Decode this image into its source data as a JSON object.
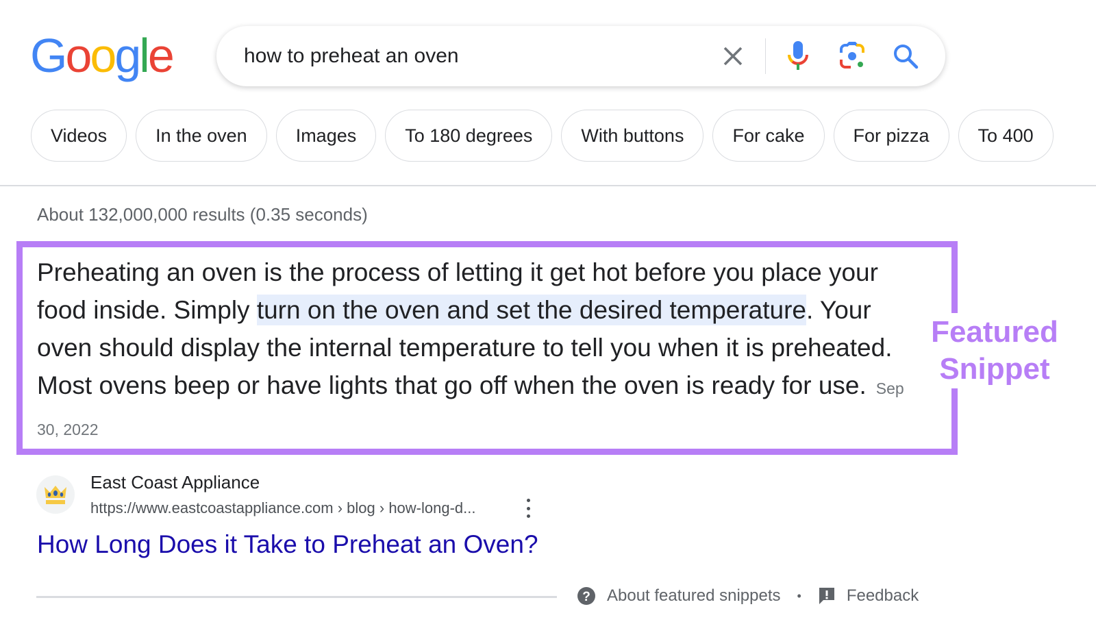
{
  "logo": {
    "letters": [
      {
        "char": "G",
        "color": "#4285F4"
      },
      {
        "char": "o",
        "color": "#EA4335"
      },
      {
        "char": "o",
        "color": "#FBBC05"
      },
      {
        "char": "g",
        "color": "#4285F4"
      },
      {
        "char": "l",
        "color": "#34A853"
      },
      {
        "char": "e",
        "color": "#EA4335"
      }
    ]
  },
  "search": {
    "value": "how to preheat an oven",
    "icons": [
      "clear-icon",
      "microphone-icon",
      "google-lens-icon",
      "search-icon"
    ]
  },
  "chips": [
    {
      "label": "Videos"
    },
    {
      "label": "In the oven"
    },
    {
      "label": "Images"
    },
    {
      "label": "To 180 degrees"
    },
    {
      "label": "With buttons"
    },
    {
      "label": "For cake"
    },
    {
      "label": "For pizza"
    },
    {
      "label": "To 400"
    }
  ],
  "result_stats": "About 132,000,000 results (0.35 seconds)",
  "featured_snippet": {
    "text_before": "Preheating an oven is the process of letting it get hot before you place your food inside. Simply ",
    "text_highlight": "turn on the oven and set the desired temperature",
    "text_after": ". Your oven should display the internal temperature to tell you when it is preheated. Most ovens beep or have lights that go off when the oven is ready for use.",
    "date": "Sep 30, 2022",
    "annotation_label": "Featured Snippet",
    "annotation_color": "#b77ef6",
    "highlight_color": "#e6eefc"
  },
  "source": {
    "site_name": "East Coast Appliance",
    "url": "https://www.eastcoastappliance.com › blog › how-long-d...",
    "title": "How Long Does it Take to Preheat an Oven?",
    "favicon": "crown-icon"
  },
  "footer": {
    "about_label": "About featured snippets",
    "separator": "•",
    "feedback_label": "Feedback"
  }
}
